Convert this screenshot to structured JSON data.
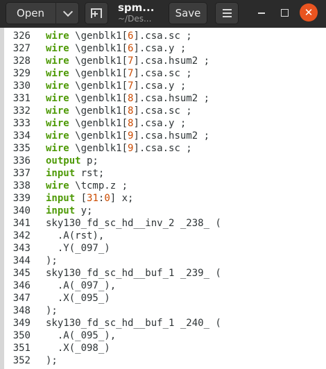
{
  "header": {
    "open_label": "Open",
    "save_label": "Save",
    "title": "spm...",
    "subtitle": "~/Des...",
    "close_glyph": "✕",
    "icons": [
      "chevron-down-icon",
      "new-tab-icon",
      "hamburger-menu-icon",
      "minimize-icon",
      "maximize-icon",
      "close-icon"
    ]
  },
  "colors": {
    "header_bg": "#2b2b2b",
    "keyword": "#4e9a06",
    "number": "#cc4b00",
    "text": "#2e3436",
    "close_button": "#e95420"
  },
  "lines": [
    {
      "n": "326",
      "parts": [
        {
          "t": "wire",
          "c": "kw"
        },
        {
          "t": " \\genblk1["
        },
        {
          "t": "6",
          "c": "num"
        },
        {
          "t": "].csa.sc ;"
        }
      ]
    },
    {
      "n": "327",
      "parts": [
        {
          "t": "wire",
          "c": "kw"
        },
        {
          "t": " \\genblk1["
        },
        {
          "t": "6",
          "c": "num"
        },
        {
          "t": "].csa.y ;"
        }
      ]
    },
    {
      "n": "328",
      "parts": [
        {
          "t": "wire",
          "c": "kw"
        },
        {
          "t": " \\genblk1["
        },
        {
          "t": "7",
          "c": "num"
        },
        {
          "t": "].csa.hsum2 ;"
        }
      ]
    },
    {
      "n": "329",
      "parts": [
        {
          "t": "wire",
          "c": "kw"
        },
        {
          "t": " \\genblk1["
        },
        {
          "t": "7",
          "c": "num"
        },
        {
          "t": "].csa.sc ;"
        }
      ]
    },
    {
      "n": "330",
      "parts": [
        {
          "t": "wire",
          "c": "kw"
        },
        {
          "t": " \\genblk1["
        },
        {
          "t": "7",
          "c": "num"
        },
        {
          "t": "].csa.y ;"
        }
      ]
    },
    {
      "n": "331",
      "parts": [
        {
          "t": "wire",
          "c": "kw"
        },
        {
          "t": " \\genblk1["
        },
        {
          "t": "8",
          "c": "num"
        },
        {
          "t": "].csa.hsum2 ;"
        }
      ]
    },
    {
      "n": "332",
      "parts": [
        {
          "t": "wire",
          "c": "kw"
        },
        {
          "t": " \\genblk1["
        },
        {
          "t": "8",
          "c": "num"
        },
        {
          "t": "].csa.sc ;"
        }
      ]
    },
    {
      "n": "333",
      "parts": [
        {
          "t": "wire",
          "c": "kw"
        },
        {
          "t": " \\genblk1["
        },
        {
          "t": "8",
          "c": "num"
        },
        {
          "t": "].csa.y ;"
        }
      ]
    },
    {
      "n": "334",
      "parts": [
        {
          "t": "wire",
          "c": "kw"
        },
        {
          "t": " \\genblk1["
        },
        {
          "t": "9",
          "c": "num"
        },
        {
          "t": "].csa.hsum2 ;"
        }
      ]
    },
    {
      "n": "335",
      "parts": [
        {
          "t": "wire",
          "c": "kw"
        },
        {
          "t": " \\genblk1["
        },
        {
          "t": "9",
          "c": "num"
        },
        {
          "t": "].csa.sc ;"
        }
      ]
    },
    {
      "n": "336",
      "parts": [
        {
          "t": "output",
          "c": "kw"
        },
        {
          "t": " p;"
        }
      ]
    },
    {
      "n": "337",
      "parts": [
        {
          "t": "input",
          "c": "kw"
        },
        {
          "t": " rst;"
        }
      ]
    },
    {
      "n": "338",
      "parts": [
        {
          "t": "wire",
          "c": "kw"
        },
        {
          "t": " \\tcmp.z ;"
        }
      ]
    },
    {
      "n": "339",
      "parts": [
        {
          "t": "input",
          "c": "kw"
        },
        {
          "t": " ["
        },
        {
          "t": "31",
          "c": "num"
        },
        {
          "t": ":"
        },
        {
          "t": "0",
          "c": "num"
        },
        {
          "t": "] x;"
        }
      ]
    },
    {
      "n": "340",
      "parts": [
        {
          "t": "input",
          "c": "kw"
        },
        {
          "t": " y;"
        }
      ]
    },
    {
      "n": "341",
      "parts": [
        {
          "t": "sky130_fd_sc_hd__inv_2 _238_ ("
        }
      ]
    },
    {
      "n": "342",
      "parts": [
        {
          "t": "  .A(rst),"
        }
      ]
    },
    {
      "n": "343",
      "parts": [
        {
          "t": "  .Y(_097_)"
        }
      ]
    },
    {
      "n": "344",
      "parts": [
        {
          "t": ");"
        }
      ]
    },
    {
      "n": "345",
      "parts": [
        {
          "t": "sky130_fd_sc_hd__buf_1 _239_ ("
        }
      ]
    },
    {
      "n": "346",
      "parts": [
        {
          "t": "  .A(_097_),"
        }
      ]
    },
    {
      "n": "347",
      "parts": [
        {
          "t": "  .X(_095_)"
        }
      ]
    },
    {
      "n": "348",
      "parts": [
        {
          "t": ");"
        }
      ]
    },
    {
      "n": "349",
      "parts": [
        {
          "t": "sky130_fd_sc_hd__buf_1 _240_ ("
        }
      ]
    },
    {
      "n": "350",
      "parts": [
        {
          "t": "  .A(_095_),"
        }
      ]
    },
    {
      "n": "351",
      "parts": [
        {
          "t": "  .X(_098_)"
        }
      ]
    },
    {
      "n": "352",
      "parts": [
        {
          "t": ");"
        }
      ]
    }
  ]
}
